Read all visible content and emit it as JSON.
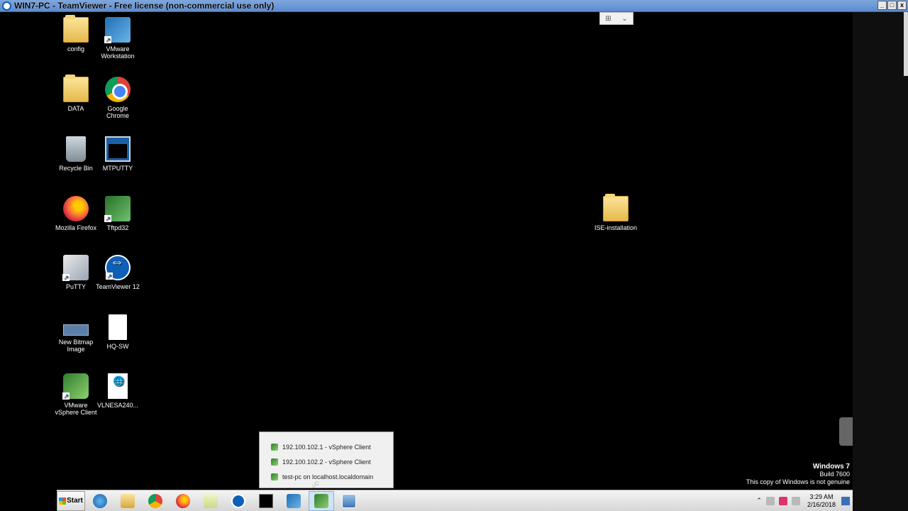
{
  "window": {
    "title": "WIN7-PC - TeamViewer - Free license (non-commercial use only)",
    "controls": [
      "_",
      "□",
      "x"
    ]
  },
  "desktop_icons": {
    "col1": [
      {
        "label": "config",
        "icon": "folder-icon"
      },
      {
        "label": "DATA",
        "icon": "folder-icon"
      },
      {
        "label": "Recycle Bin",
        "icon": "recycle-bin-icon"
      },
      {
        "label": "Mozilla Firefox",
        "icon": "firefox-icon"
      },
      {
        "label": "PuTTY",
        "icon": "putty-icon"
      },
      {
        "label": "New Bitmap Image",
        "icon": "bitmap-icon"
      },
      {
        "label": "VMware vSphere Client",
        "icon": "vsphere-icon"
      }
    ],
    "col2": [
      {
        "label": "VMware Workstation",
        "icon": "vmware-workstation-icon"
      },
      {
        "label": "Google Chrome",
        "icon": "chrome-icon"
      },
      {
        "label": "MTPUTTY",
        "icon": "mtputty-icon"
      },
      {
        "label": "Tftpd32",
        "icon": "tftpd-icon"
      },
      {
        "label": "TeamViewer 12",
        "icon": "teamviewer-icon"
      },
      {
        "label": "HQ-SW",
        "icon": "document-icon"
      },
      {
        "label": "VLNESA240...",
        "icon": "web-document-icon"
      }
    ],
    "ise": {
      "label": "ISE-installation",
      "icon": "folder-icon"
    }
  },
  "jumplist": {
    "items": [
      "192.100.102.1 - vSphere Client",
      "192.100.102.2 - vSphere Client",
      "test-pc on localhost.localdomain"
    ]
  },
  "watermark": {
    "line1": "Windows 7",
    "line2": "Build 7600",
    "line3": "This copy of Windows is not genuine"
  },
  "taskbar": {
    "start_label": "Start",
    "buttons": [
      "internet-explorer-icon",
      "explorer-icon",
      "chrome-icon",
      "firefox-icon",
      "folder-icon",
      "teamviewer-icon",
      "command-prompt-icon",
      "vmware-workstation-icon",
      "vsphere-icon",
      "remote-desktop-icon"
    ],
    "active_button": "vsphere-icon"
  },
  "clock": {
    "time": "3:29 AM",
    "date": "2/16/2018"
  },
  "colors": {
    "titlebar": "#5c8bcf",
    "desktop": "#000000",
    "taskbar": "#d6d6d6"
  }
}
